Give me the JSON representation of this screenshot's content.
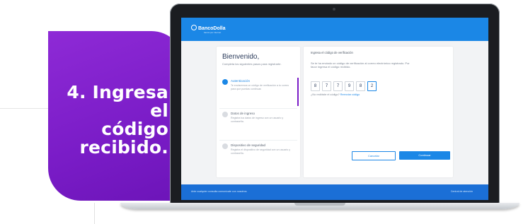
{
  "callout": {
    "lines": [
      "4. Ingresa el",
      "código",
      "recibido."
    ]
  },
  "colors": {
    "purple": "#7a1cc7",
    "blue": "#1b87e6"
  },
  "screen": {
    "brand": "BancoDolla",
    "brand_sub": "banca por internet",
    "welcome_title": "Bienvenido,",
    "welcome_desc": "Completa los siguientes pasos para registrarte.",
    "steps": [
      {
        "title": "Autenticación",
        "desc": "Te enviaremos un código de verificación a tu correo para que puedas continuar."
      },
      {
        "title": "Datos de ingreso",
        "desc": "Registra tus datos de ingreso con un usuario y contraseña."
      },
      {
        "title": "Dispositivo de seguridad",
        "desc": "Registra el dispositivo de seguridad con un usuario y contraseña."
      }
    ],
    "verify_title": "Ingresa el código de verificación",
    "verify_desc": "Se te ha enviado un código de verificación al correo electrónico registrado. Por favor ingresa el código recibido.",
    "code": [
      "8",
      "7",
      "7",
      "9",
      "8",
      "2"
    ],
    "resend_text": "¿No recibiste el código?",
    "resend_link": "Reenviar código",
    "cancel_label": "Cancelar",
    "continue_label": "Continuar",
    "footer_left": "Ante cualquier consulta comunícate con nosotros",
    "footer_right": "Central de atención"
  }
}
